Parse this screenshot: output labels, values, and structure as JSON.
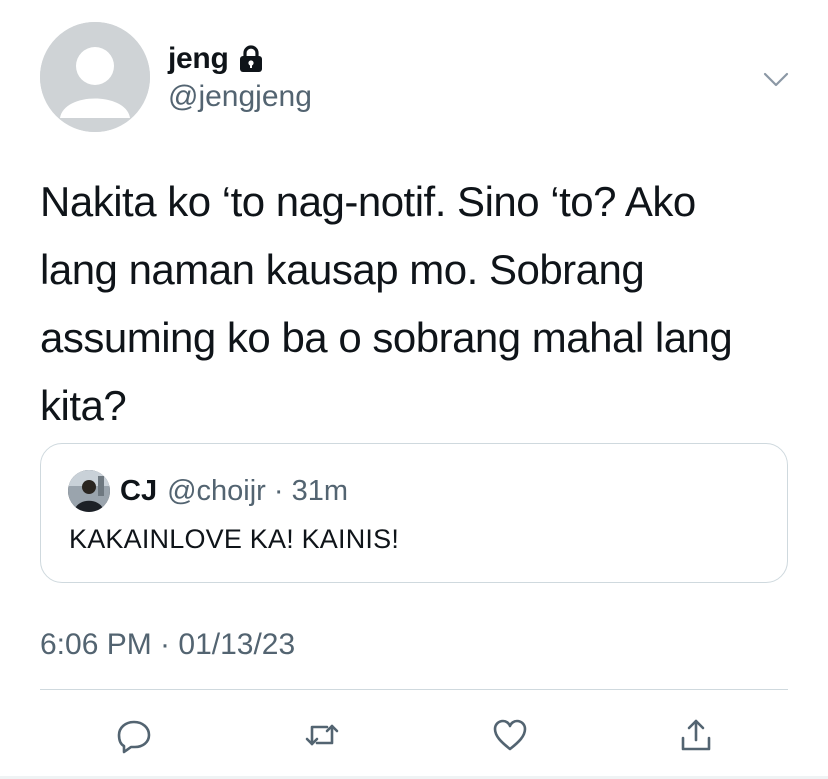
{
  "author": {
    "display_name": "jeng",
    "handle": "@jengjeng",
    "protected_icon": "lock-icon",
    "avatar": "default-avatar"
  },
  "tweet": {
    "text": "Nakita ko ‘to nag-notif. Sino ‘to? Ako\nlang naman kausap mo. Sobrang\nassuming ko ba o sobrang mahal lang\nkita?",
    "timestamp": "6:06 PM · 01/13/23"
  },
  "quoted_tweet": {
    "display_name": "CJ",
    "handle_time": "@choijr · 31m",
    "text": "KAKAINLOVE KA! KAINIS!"
  },
  "actions": [
    {
      "icon": "reply-icon"
    },
    {
      "icon": "retweet-icon"
    },
    {
      "icon": "like-icon"
    },
    {
      "icon": "share-icon"
    }
  ],
  "colors": {
    "primary_text": "#0f1419",
    "secondary_text": "#536471",
    "border": "#cfd9de"
  }
}
